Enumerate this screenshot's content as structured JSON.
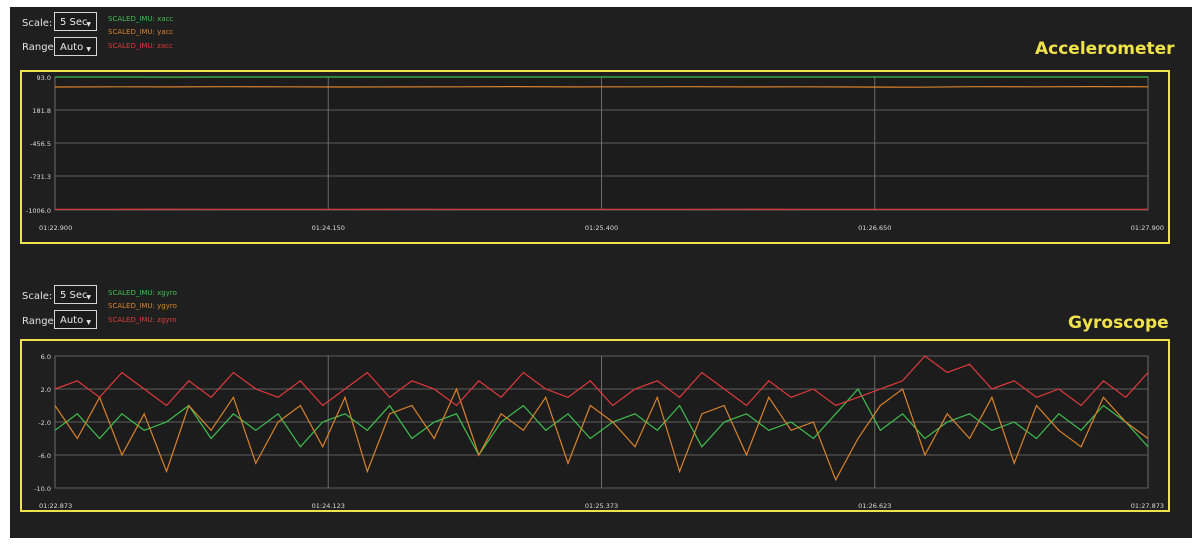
{
  "panels": [
    {
      "title": "Accelerometer",
      "scale_label": "Scale:",
      "scale_value": "5 Sec",
      "range_label": "Range:",
      "range_value": "Auto",
      "legend": [
        {
          "label": "SCALED_IMU: xacc",
          "color": "#3fbf4f"
        },
        {
          "label": "SCALED_IMU: yacc",
          "color": "#d9822b"
        },
        {
          "label": "SCALED_IMU: zacc",
          "color": "#e0393b"
        }
      ]
    },
    {
      "title": "Gyroscope",
      "scale_label": "Scale:",
      "scale_value": "5 Sec",
      "range_label": "Range:",
      "range_value": "Auto",
      "legend": [
        {
          "label": "SCALED_IMU: xgyro",
          "color": "#3fbf4f"
        },
        {
          "label": "SCALED_IMU: ygyro",
          "color": "#d9822b"
        },
        {
          "label": "SCALED_IMU: zgyro",
          "color": "#e0393b"
        }
      ]
    }
  ],
  "chart_data": [
    {
      "type": "line",
      "grid": true,
      "x_ticks": [
        "01:22.900",
        "01:24.150",
        "01:25.400",
        "01:26.650",
        "01:27.900"
      ],
      "y_ticks": [
        "93.0",
        "181.8",
        "-456.5",
        "-731.3",
        "-1006.0"
      ],
      "ylim": [
        -1006.0,
        93.0
      ],
      "series": [
        {
          "name": "SCALED_IMU: xacc",
          "color": "#3fbf4f",
          "values": [
            93,
            93,
            92.5,
            93,
            93,
            92.8,
            93,
            93,
            93,
            92.8,
            93,
            93,
            93,
            93,
            93,
            93,
            92.9,
            93,
            93,
            93
          ]
        },
        {
          "name": "SCALED_IMU: yacc",
          "color": "#d9822b",
          "values": [
            10,
            12,
            11,
            13,
            12,
            10,
            11,
            12,
            14,
            11,
            12,
            13,
            11,
            12,
            10,
            9,
            13,
            12,
            14,
            12
          ]
        },
        {
          "name": "SCALED_IMU: zacc",
          "color": "#e0393b",
          "values": [
            -1000,
            -1000,
            -999,
            -1000,
            -1000,
            -1000,
            -999,
            -1000,
            -1000,
            -1000,
            -1000,
            -1000,
            -999,
            -1000,
            -1000,
            -1000,
            -1000,
            -1000,
            -1000,
            -1000
          ]
        }
      ]
    },
    {
      "type": "line",
      "grid": true,
      "x_ticks": [
        "01:22.873",
        "01:24.123",
        "01:25.373",
        "01:26.623",
        "01:27.873"
      ],
      "y_ticks": [
        "6.0",
        "2.0",
        "-2.0",
        "-6.0",
        "-10.0"
      ],
      "ylim": [
        -10.0,
        6.0
      ],
      "series": [
        {
          "name": "SCALED_IMU: xgyro",
          "color": "#3fbf4f",
          "values": [
            -3,
            -1,
            -4,
            -1,
            -3,
            -2,
            0,
            -4,
            -1,
            -3,
            -1,
            -5,
            -2,
            -1,
            -3,
            0,
            -4,
            -2,
            -1,
            -6,
            -2,
            0,
            -3,
            -1,
            -4,
            -2,
            -1,
            -3,
            0,
            -5,
            -2,
            -1,
            -3,
            -2,
            -4,
            -1,
            2,
            -3,
            -1,
            -4,
            -2,
            -1,
            -3,
            -2,
            -4,
            -1,
            -3,
            0,
            -2,
            -5
          ]
        },
        {
          "name": "SCALED_IMU: ygyro",
          "color": "#d9822b",
          "values": [
            0,
            -4,
            1,
            -6,
            -1,
            -8,
            0,
            -3,
            1,
            -7,
            -2,
            0,
            -5,
            1,
            -8,
            -1,
            0,
            -4,
            2,
            -6,
            -1,
            -3,
            1,
            -7,
            0,
            -2,
            -5,
            1,
            -8,
            -1,
            0,
            -6,
            1,
            -3,
            -2,
            -9,
            -4,
            0,
            2,
            -6,
            -1,
            -4,
            1,
            -7,
            0,
            -3,
            -5,
            1,
            -2,
            -4
          ]
        },
        {
          "name": "SCALED_IMU: zgyro",
          "color": "#e0393b",
          "values": [
            2,
            3,
            1,
            4,
            2,
            0,
            3,
            1,
            4,
            2,
            1,
            3,
            0,
            2,
            4,
            1,
            3,
            2,
            0,
            3,
            1,
            4,
            2,
            1,
            3,
            0,
            2,
            3,
            1,
            4,
            2,
            0,
            3,
            1,
            2,
            0,
            1,
            2,
            3,
            6,
            4,
            5,
            2,
            3,
            1,
            2,
            0,
            3,
            1,
            4
          ]
        }
      ]
    }
  ]
}
